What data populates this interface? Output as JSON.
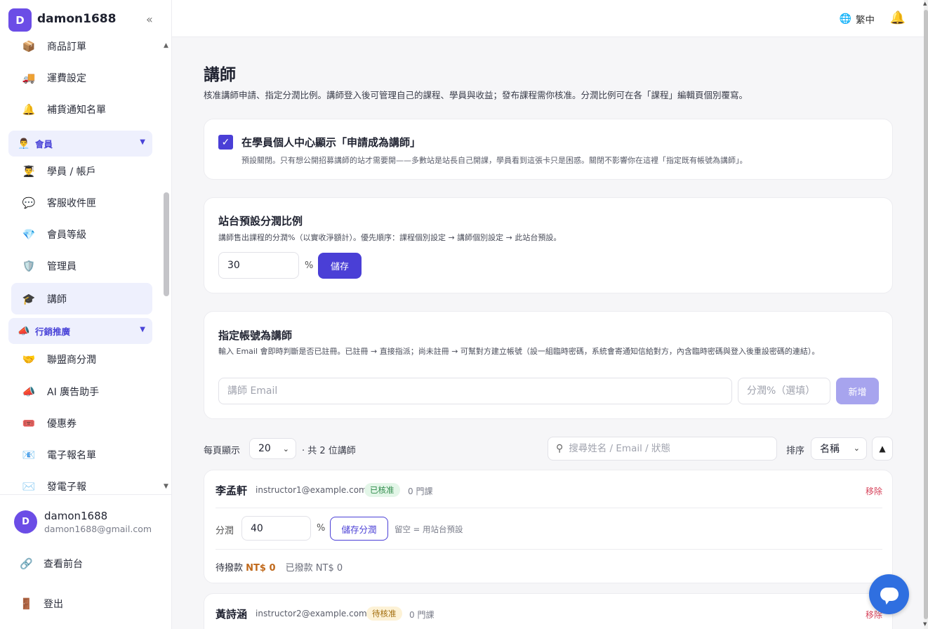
{
  "site": {
    "logo_letter": "D",
    "name": "damon1688",
    "collapse_icon": "«"
  },
  "sidebar": {
    "items": [
      {
        "label": "商品訂單",
        "icon": "📦"
      },
      {
        "label": "運費設定",
        "icon": "🚚"
      },
      {
        "label": "補貨通知名單",
        "icon": "🔔"
      },
      {
        "label": "會員",
        "icon": "👨‍💼",
        "group": true
      },
      {
        "label": "學員 / 帳戶",
        "icon": "👨‍🎓"
      },
      {
        "label": "客服收件匣",
        "icon": "💬"
      },
      {
        "label": "會員等級",
        "icon": "💎"
      },
      {
        "label": "管理員",
        "icon": "🛡️"
      },
      {
        "label": "講師",
        "icon": "🎓",
        "active": true
      },
      {
        "label": "行銷推廣",
        "icon": "📣",
        "group": true
      },
      {
        "label": "聯盟商分潤",
        "icon": "🤝"
      },
      {
        "label": "AI 廣告助手",
        "icon": "📣"
      },
      {
        "label": "優惠券",
        "icon": "🎟️"
      },
      {
        "label": "電子報名單",
        "icon": "📧"
      },
      {
        "label": "發電子報",
        "icon": "✉️"
      }
    ],
    "group_caret": "▼"
  },
  "user": {
    "initial": "D",
    "name": "damon1688",
    "email": "damon1688@gmail.com"
  },
  "footer_links": {
    "storefront": "查看前台",
    "logout": "登出"
  },
  "topbar": {
    "language": "繁中"
  },
  "page": {
    "title": "講師",
    "description": "核准講師申請、指定分潤比例。講師登入後可管理自己的課程、學員與收益；發布課程需你核准。分潤比例可在各「課程」編輯頁個別覆寫。"
  },
  "apply_setting": {
    "checked": true,
    "label": "在學員個人中心顯示「申請成為講師」",
    "hint": "預設關閉。只有想公開招募講師的站才需要開——多數站是站長自己開課，學員看到這張卡只是困惑。關閉不影響你在這裡「指定既有帳號為講師」。"
  },
  "default_share": {
    "title": "站台預設分潤比例",
    "subtitle": "講師售出課程的分潤%（以實收淨額計）。優先順序：課程個別設定 → 講師個別設定 → 此站台預設。",
    "value": "30",
    "unit": "%",
    "save_label": "儲存"
  },
  "assign": {
    "title": "指定帳號為講師",
    "subtitle": "輸入 Email 會即時判斷是否已註冊。已註冊 → 直接指派；尚未註冊 → 可幫對方建立帳號（設一組臨時密碼，系統會寄通知信給對方，內含臨時密碼與登入後重設密碼的連結）。",
    "email_placeholder": "講師 Email",
    "share_placeholder": "分潤%（選填）",
    "add_label": "新增"
  },
  "list_controls": {
    "per_page_label": "每頁顯示",
    "per_page_value": "20",
    "total_text": "· 共 2 位講師",
    "search_placeholder": "搜尋姓名 / Email / 狀態",
    "sort_label": "排序",
    "sort_value": "名稱",
    "sort_dir": "▲"
  },
  "instructors": [
    {
      "name": "李孟軒",
      "email": "instructor1@example.com",
      "status": "已核准",
      "courses": "0 門課",
      "remove_label": "移除",
      "share_label": "分潤",
      "share_value": "40",
      "unit": "%",
      "save_share_label": "儲存分潤",
      "blank_hint": "留空 = 用站台預設",
      "pending_label": "待撥款",
      "pending_amount": "NT$ 0",
      "paid_text": "已撥款 NT$ 0"
    },
    {
      "name": "黃詩涵",
      "email": "instructor2@example.com",
      "status": "待核准",
      "courses": "0 門課",
      "remove_label": "移除"
    }
  ]
}
